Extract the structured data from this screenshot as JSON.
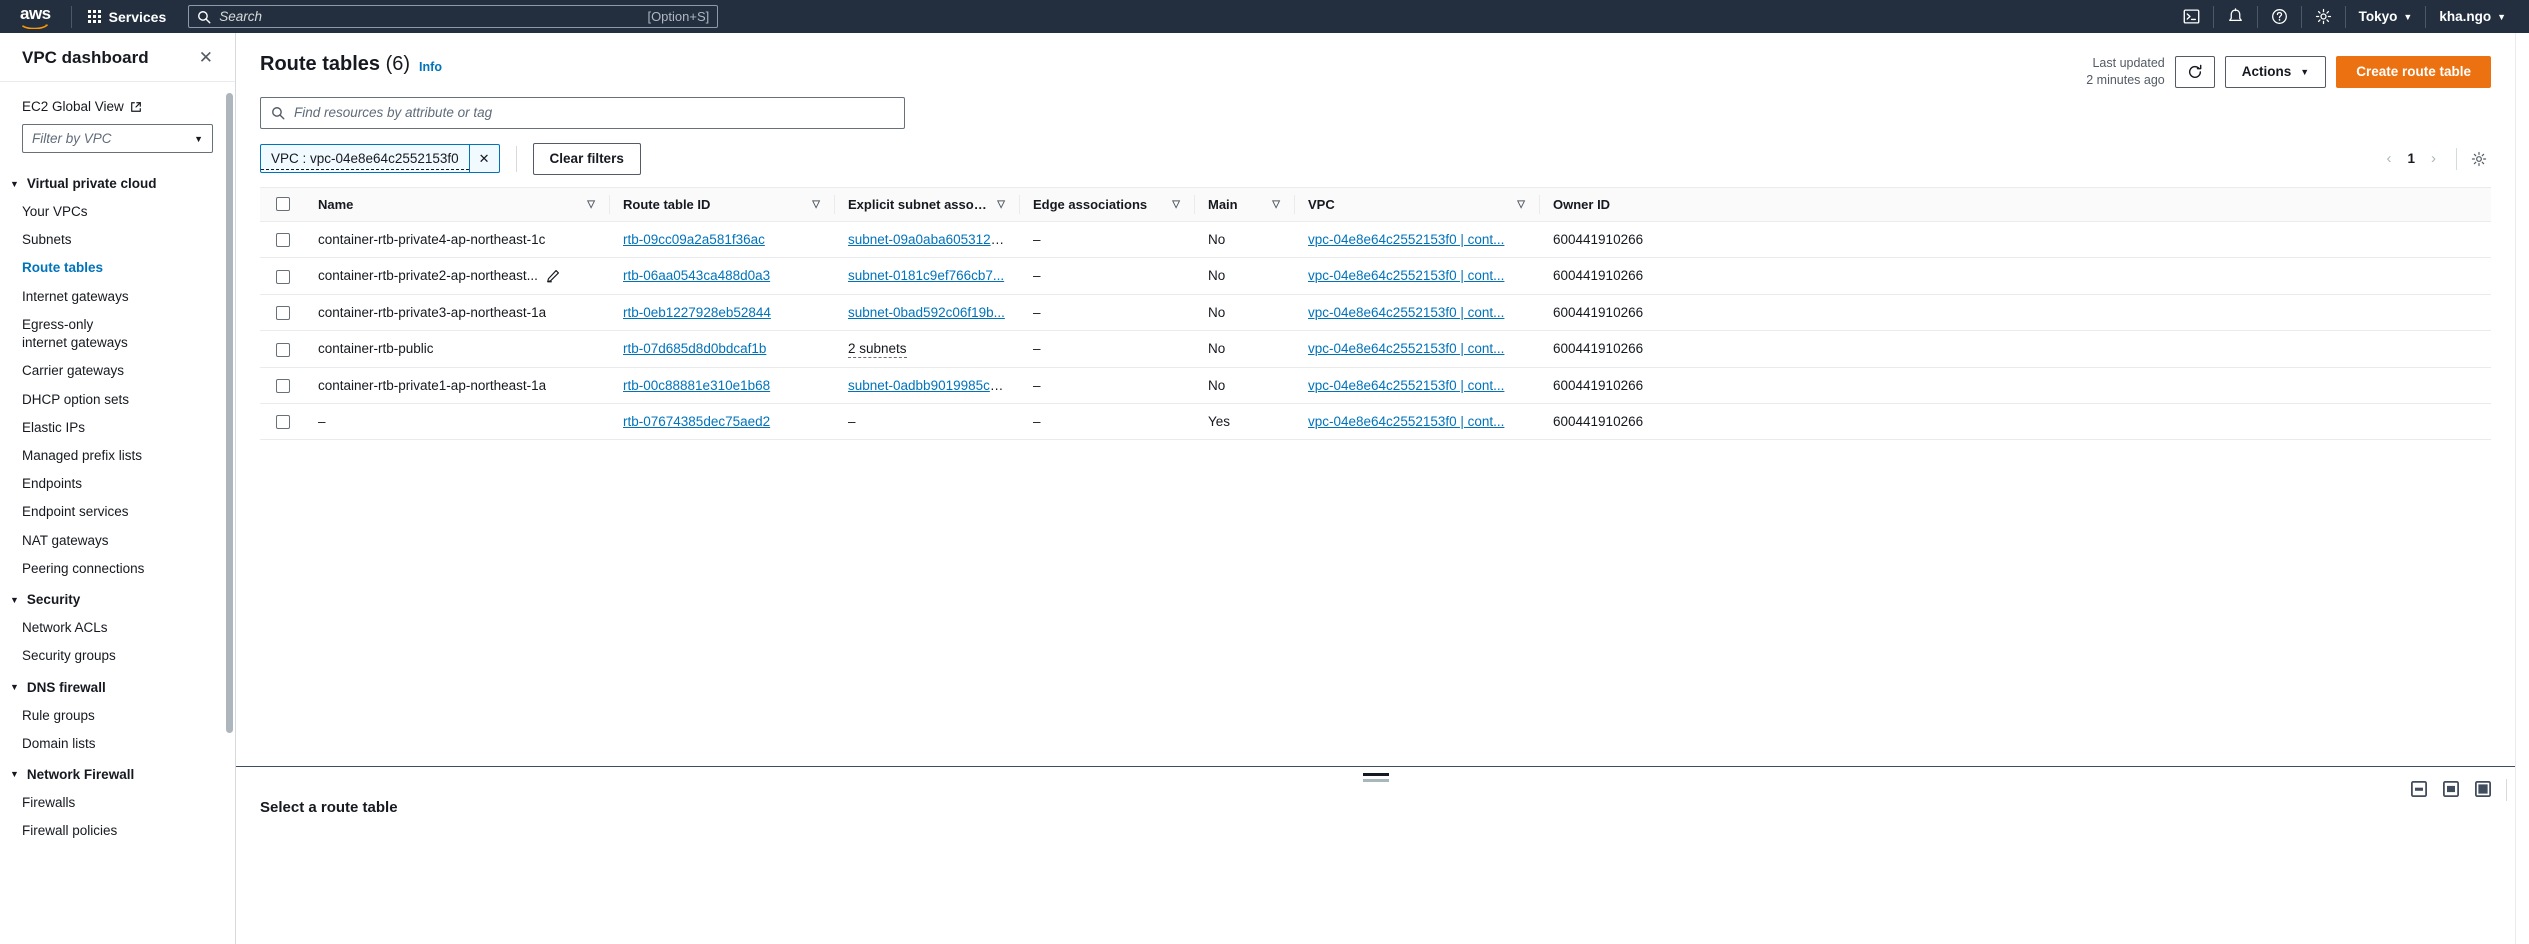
{
  "topnav": {
    "logo_alt": "aws",
    "services_label": "Services",
    "search_placeholder": "Search",
    "search_shortcut": "[Option+S]",
    "cloudshell_icon": "cloudshell-icon",
    "notifications_icon": "bell-icon",
    "help_icon": "question-circle-icon",
    "settings_icon": "gear-icon",
    "region_label": "Tokyo",
    "account_label": "kha.ngo"
  },
  "sidebar": {
    "title": "VPC dashboard",
    "close_icon": "close-icon",
    "ec2_global_view": "EC2 Global View",
    "external_link_icon": "external-link-icon",
    "filter_placeholder": "Filter by VPC",
    "groups": [
      {
        "label": "Virtual private cloud",
        "items": [
          {
            "label": "Your VPCs",
            "active": false
          },
          {
            "label": "Subnets",
            "active": false
          },
          {
            "label": "Route tables",
            "active": true
          },
          {
            "label": "Internet gateways",
            "active": false
          },
          {
            "label": "Egress-only internet gateways",
            "active": false
          },
          {
            "label": "Carrier gateways",
            "active": false
          },
          {
            "label": "DHCP option sets",
            "active": false
          },
          {
            "label": "Elastic IPs",
            "active": false
          },
          {
            "label": "Managed prefix lists",
            "active": false
          },
          {
            "label": "Endpoints",
            "active": false
          },
          {
            "label": "Endpoint services",
            "active": false
          },
          {
            "label": "NAT gateways",
            "active": false
          },
          {
            "label": "Peering connections",
            "active": false
          }
        ]
      },
      {
        "label": "Security",
        "items": [
          {
            "label": "Network ACLs",
            "active": false
          },
          {
            "label": "Security groups",
            "active": false
          }
        ]
      },
      {
        "label": "DNS firewall",
        "items": [
          {
            "label": "Rule groups",
            "active": false
          },
          {
            "label": "Domain lists",
            "active": false
          }
        ]
      },
      {
        "label": "Network Firewall",
        "items": [
          {
            "label": "Firewalls",
            "active": false
          },
          {
            "label": "Firewall policies",
            "active": false
          }
        ]
      }
    ]
  },
  "page": {
    "title": "Route tables",
    "count": "(6)",
    "info_label": "Info",
    "last_updated_line1": "Last updated",
    "last_updated_line2": "2 minutes ago",
    "refresh_icon": "refresh-icon",
    "actions_label": "Actions",
    "create_label": "Create route table",
    "search_placeholder": "Find resources by attribute or tag",
    "search_icon": "search-icon",
    "filter_chip": "VPC : vpc-04e8e64c2552153f0",
    "chip_close_icon": "close-icon",
    "clear_filters_label": "Clear filters",
    "pagination": {
      "prev_icon": "chevron-left-icon",
      "page": "1",
      "next_icon": "chevron-right-icon",
      "settings_icon": "gear-icon"
    }
  },
  "table": {
    "columns": [
      "Name",
      "Route table ID",
      "Explicit subnet associ...",
      "Edge associations",
      "Main",
      "VPC",
      "Owner ID"
    ],
    "sort_icon": "sort-icon",
    "rows": [
      {
        "name": "container-rtb-private4-ap-northeast-1c",
        "has_edit": false,
        "route_table_id": "rtb-09cc09a2a581f36ac",
        "subnet": "subnet-09a0aba6053128...",
        "subnet_is_link": true,
        "edge": "–",
        "main": "No",
        "vpc": "vpc-04e8e64c2552153f0 | cont...",
        "owner_id": "600441910266"
      },
      {
        "name": "container-rtb-private2-ap-northeast...",
        "has_edit": true,
        "route_table_id": "rtb-06aa0543ca488d0a3",
        "subnet": "subnet-0181c9ef766cb7...",
        "subnet_is_link": true,
        "edge": "–",
        "main": "No",
        "vpc": "vpc-04e8e64c2552153f0 | cont...",
        "owner_id": "600441910266"
      },
      {
        "name": "container-rtb-private3-ap-northeast-1a",
        "has_edit": false,
        "route_table_id": "rtb-0eb1227928eb52844",
        "subnet": "subnet-0bad592c06f19b...",
        "subnet_is_link": true,
        "edge": "–",
        "main": "No",
        "vpc": "vpc-04e8e64c2552153f0 | cont...",
        "owner_id": "600441910266"
      },
      {
        "name": "container-rtb-public",
        "has_edit": false,
        "route_table_id": "rtb-07d685d8d0bdcaf1b",
        "subnet": "2 subnets",
        "subnet_is_link": false,
        "edge": "–",
        "main": "No",
        "vpc": "vpc-04e8e64c2552153f0 | cont...",
        "owner_id": "600441910266"
      },
      {
        "name": "container-rtb-private1-ap-northeast-1a",
        "has_edit": false,
        "route_table_id": "rtb-00c88881e310e1b68",
        "subnet": "subnet-0adbb9019985c9...",
        "subnet_is_link": true,
        "edge": "–",
        "main": "No",
        "vpc": "vpc-04e8e64c2552153f0 | cont...",
        "owner_id": "600441910266"
      },
      {
        "name": "–",
        "has_edit": false,
        "route_table_id": "rtb-07674385dec75aed2",
        "subnet": "–",
        "subnet_is_link": false,
        "edge": "–",
        "main": "Yes",
        "vpc": "vpc-04e8e64c2552153f0 | cont...",
        "owner_id": "600441910266"
      }
    ]
  },
  "split_panel": {
    "title": "Select a route table",
    "drag_handle_icon": "drag-handle-icon",
    "layout_icons": [
      "panel-small-icon",
      "panel-medium-icon",
      "panel-large-icon"
    ]
  },
  "colors": {
    "nav_bg": "#232f3e",
    "link": "#0073bb",
    "primary": "#ec7211",
    "text": "#16191f"
  }
}
